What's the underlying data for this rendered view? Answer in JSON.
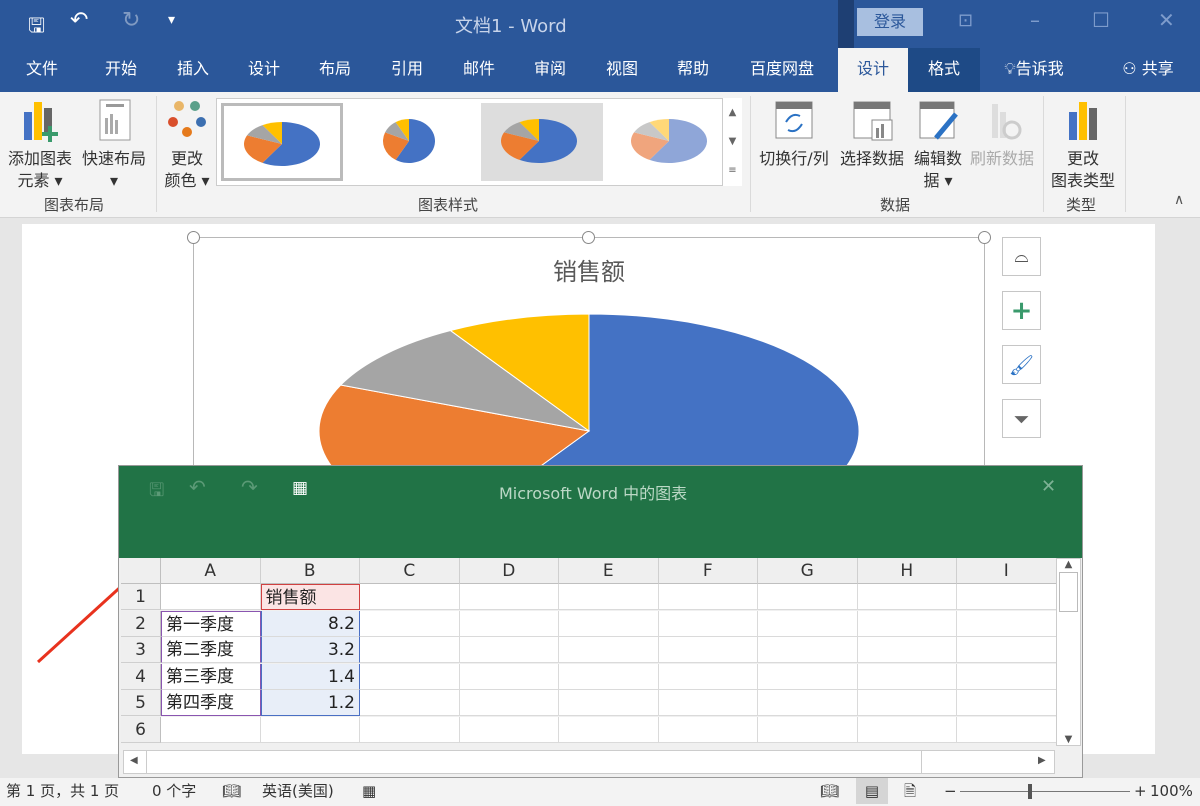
{
  "titlebar": {
    "title": "文档1  -  Word",
    "login": "登录",
    "qat_more": "▾"
  },
  "tabs": [
    {
      "label": "文件"
    },
    {
      "label": "开始"
    },
    {
      "label": "插入"
    },
    {
      "label": "设计"
    },
    {
      "label": "布局"
    },
    {
      "label": "引用"
    },
    {
      "label": "邮件"
    },
    {
      "label": "审阅"
    },
    {
      "label": "视图"
    },
    {
      "label": "帮助"
    },
    {
      "label": "百度网盘"
    },
    {
      "label": "设计",
      "active": true
    },
    {
      "label": "格式"
    },
    {
      "label": "告诉我"
    },
    {
      "label": "共享"
    }
  ],
  "ribbon": {
    "add_element": "添加图表",
    "add_element2": "元素 ▾",
    "quick_layout": "快速布局",
    "quick_layout2": "▾",
    "change_color": "更改",
    "change_color2": "颜色 ▾",
    "switch_rowcol": "切换行/列",
    "select_data": "选择数据",
    "edit_data": "编辑数",
    "edit_data2": "据 ▾",
    "refresh_data": "刷新数据",
    "change_type": "更改",
    "change_type2": "图表类型",
    "groups": {
      "layout": "图表布局",
      "styles": "图表样式",
      "data": "数据",
      "type": "类型"
    }
  },
  "chart": {
    "title": "销售额",
    "colors": [
      "#4472c4",
      "#ed7d31",
      "#a5a5a5",
      "#ffc000"
    ]
  },
  "chart_data": {
    "type": "pie",
    "title": "销售额",
    "categories": [
      "第一季度",
      "第二季度",
      "第三季度",
      "第四季度"
    ],
    "values": [
      8.2,
      3.2,
      1.4,
      1.2
    ]
  },
  "excel": {
    "title": "Microsoft Word 中的图表",
    "columns": [
      "A",
      "B",
      "C",
      "D",
      "E",
      "F",
      "G",
      "H",
      "I"
    ],
    "rows": [
      [
        "",
        "销售额"
      ],
      [
        "第一季度",
        "8.2"
      ],
      [
        "第二季度",
        "3.2"
      ],
      [
        "第三季度",
        "1.4"
      ],
      [
        "第四季度",
        "1.2"
      ],
      [
        "",
        ""
      ]
    ],
    "row_numbers": [
      "1",
      "2",
      "3",
      "4",
      "5",
      "6"
    ]
  },
  "status": {
    "page": "第 1 页，共 1 页",
    "words": "0 个字",
    "lang": "英语(美国)",
    "zoom": "100%"
  }
}
